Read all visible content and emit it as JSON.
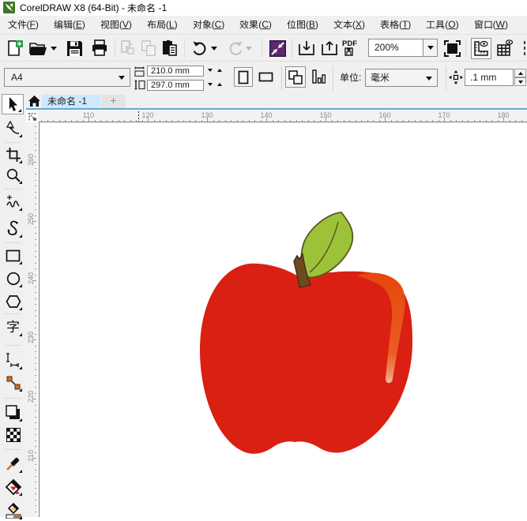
{
  "window": {
    "title": "CorelDRAW X8 (64-Bit) - 未命名 -1",
    "logo": "coreldraw-logo"
  },
  "menubar": {
    "items": [
      {
        "label": "文件(F)"
      },
      {
        "label": "编辑(E)"
      },
      {
        "label": "视图(V)"
      },
      {
        "label": "布局(L)"
      },
      {
        "label": "对象(C)"
      },
      {
        "label": "效果(C)"
      },
      {
        "label": "位图(B)"
      },
      {
        "label": "文本(X)"
      },
      {
        "label": "表格(T)"
      },
      {
        "label": "工具(O)"
      },
      {
        "label": "窗口(W)"
      }
    ]
  },
  "toolbar": {
    "zoom_level": "200%",
    "pdf_label": "PDF",
    "icons": [
      "new-document",
      "open",
      "save",
      "print",
      "cut",
      "copy",
      "paste",
      "undo",
      "redo",
      "application-launcher",
      "import",
      "export",
      "publish-to-pdf",
      "zoom-levels",
      "full-screen-preview",
      "show-rulers",
      "show-grid",
      "show-guidelines"
    ]
  },
  "property_bar": {
    "page_size": "A4",
    "page_width": "210.0 mm",
    "page_height": "297.0 mm",
    "units_label": "单位:",
    "units_value": "毫米",
    "nudge_distance": ".1 mm",
    "icons": [
      "page-width",
      "page-height",
      "portrait",
      "landscape",
      "all-pages",
      "current-page",
      "nudge-offset"
    ]
  },
  "tabbar": {
    "active_tab": "未命名 -1",
    "new_tab_label": "+"
  },
  "rulers": {
    "horizontal": [
      "110",
      "120",
      "130",
      "140",
      "150",
      "160",
      "170",
      "180"
    ],
    "vertical": [
      "260",
      "250",
      "240",
      "230",
      "220",
      "210"
    ]
  },
  "toolbox": {
    "tools": [
      "pick",
      "shape",
      "crop",
      "zoom",
      "freehand",
      "bspline",
      "rectangle",
      "ellipse",
      "polygon",
      "text",
      "parallel-dimension",
      "straight-line-connector",
      "drop-shadow",
      "transparency",
      "color-eyedropper",
      "smart-fill",
      "interactive-fill"
    ],
    "selected": "pick"
  },
  "canvas": {
    "artwork": "red apple with leaf and stem",
    "colors": {
      "apple_body": "#da2012",
      "apple_highlight_start": "#e8480c",
      "apple_highlight_end": "#f5b894",
      "leaf_fill": "#9cc23a",
      "leaf_outline": "#5c581d",
      "stem_fill": "#6f4a20",
      "stem_outline": "#45311a"
    }
  }
}
